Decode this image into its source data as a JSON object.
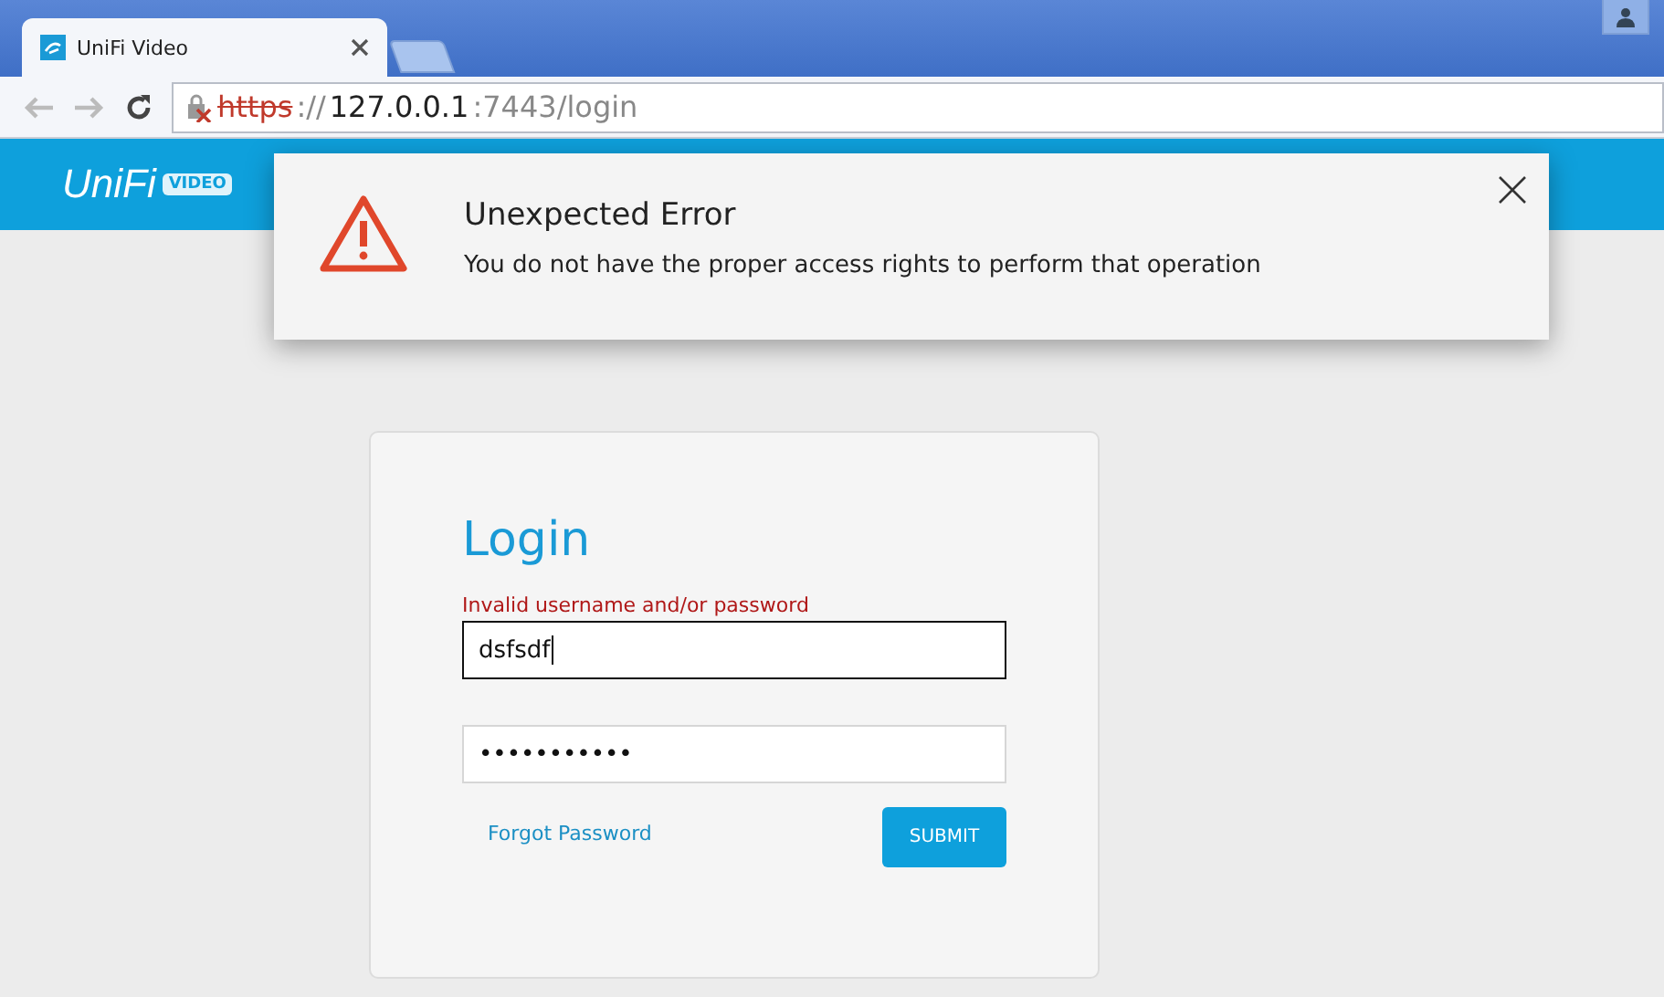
{
  "browser": {
    "tabs": [
      {
        "title": "UniFi Video",
        "selected": true
      }
    ],
    "address": {
      "scheme": "https",
      "separator": "://",
      "host": "127.0.0.1",
      "rest": ":7443/login",
      "insecure": true
    }
  },
  "header": {
    "logo": "UniFi",
    "logo_badge": "VIDEO"
  },
  "error_dialog": {
    "title": "Unexpected Error",
    "message": "You do not have the proper access rights to perform that operation"
  },
  "login": {
    "title": "Login",
    "error": "Invalid username and/or password",
    "username": {
      "value": "dsfsdf",
      "focused": true
    },
    "password": {
      "value": "•••••••••••",
      "focused": false
    },
    "forgot_link": "Forgot Password",
    "submit": "SUBMIT"
  }
}
